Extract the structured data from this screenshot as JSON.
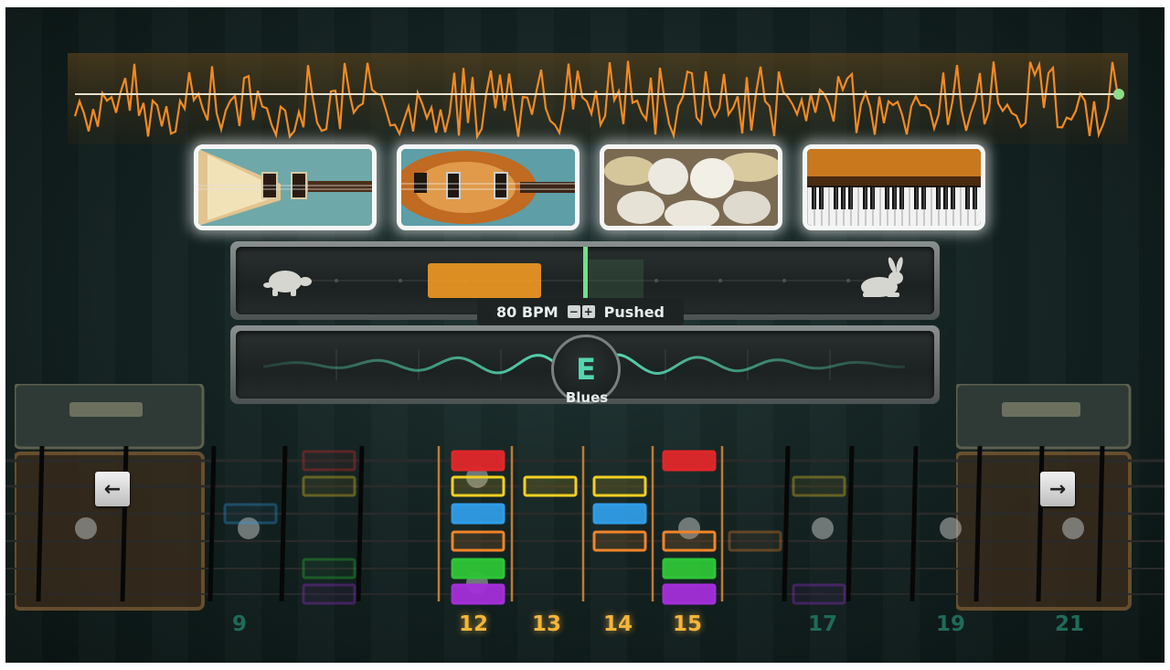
{
  "instruments": [
    {
      "name": "flying-v-guitar-icon"
    },
    {
      "name": "bass-guitar-icon"
    },
    {
      "name": "drum-kit-icon"
    },
    {
      "name": "keyboard-icon"
    }
  ],
  "tempo": {
    "bpm_label": "80 BPM",
    "minus": "−",
    "plus": "+",
    "feel_label": "Pushed",
    "slow_icon": "tortoise-icon",
    "fast_icon": "rabbit-icon"
  },
  "key": {
    "note": "E",
    "scale": "Blues"
  },
  "navigation": {
    "left": "←",
    "right": "→"
  },
  "fretboard": {
    "fret_numbers": [
      {
        "label": "9",
        "active": false
      },
      {
        "label": "12",
        "active": true
      },
      {
        "label": "13",
        "active": true
      },
      {
        "label": "14",
        "active": true
      },
      {
        "label": "15",
        "active": true
      },
      {
        "label": "17",
        "active": false
      },
      {
        "label": "19",
        "active": false
      },
      {
        "label": "21",
        "active": false
      }
    ]
  },
  "colors": {
    "waveform": "#f08a24",
    "accent_green": "#54d6b0",
    "tempo_marker": "#f29a22",
    "string_colors": [
      "#e0272a",
      "#f2d022",
      "#2f9ce6",
      "#f0842a",
      "#2ec436",
      "#a32ed8"
    ],
    "fret_active": "#f5b53a",
    "fret_inactive": "#1f6b5a"
  }
}
